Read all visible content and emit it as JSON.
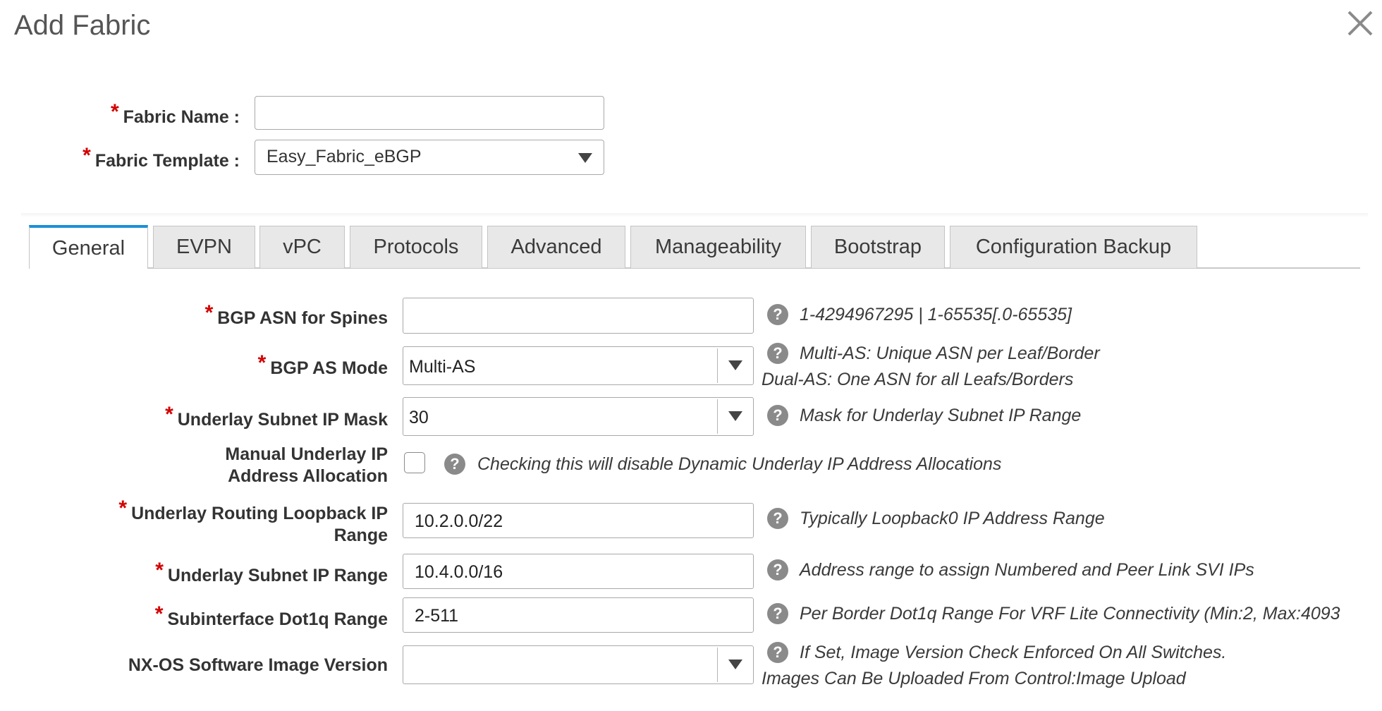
{
  "dialog": {
    "title": "Add Fabric",
    "close_icon": "close-icon"
  },
  "required_marker": "*",
  "fabric_name": {
    "label": "Fabric Name :",
    "value": ""
  },
  "fabric_template": {
    "label": "Fabric Template :",
    "selected": "Easy_Fabric_eBGP"
  },
  "tabs": [
    {
      "label": "General",
      "active": true
    },
    {
      "label": "EVPN",
      "active": false
    },
    {
      "label": "vPC",
      "active": false
    },
    {
      "label": "Protocols",
      "active": false
    },
    {
      "label": "Advanced",
      "active": false
    },
    {
      "label": "Manageability",
      "active": false
    },
    {
      "label": "Bootstrap",
      "active": false
    },
    {
      "label": "Configuration Backup",
      "active": false
    }
  ],
  "general": {
    "bgp_asn": {
      "label": "BGP ASN for Spines",
      "value": "",
      "hint": "1-4294967295 | 1-65535[.0-65535]"
    },
    "bgp_as_mode": {
      "label": "BGP AS Mode",
      "selected": "Multi-AS",
      "hint_line1": "Multi-AS: Unique ASN per Leaf/Border",
      "hint_line2": "Dual-AS: One ASN for all Leafs/Borders"
    },
    "underlay_subnet_mask": {
      "label": "Underlay Subnet IP Mask",
      "selected": "30",
      "hint": "Mask for Underlay Subnet IP Range"
    },
    "manual_underlay": {
      "label_line1": "Manual Underlay IP",
      "label_line2": "Address Allocation",
      "checked": false,
      "hint": "Checking this will disable Dynamic Underlay IP Address Allocations"
    },
    "loopback_range": {
      "label_line1": "Underlay Routing Loopback IP",
      "label_line2": "Range",
      "value": "10.2.0.0/22",
      "hint": "Typically Loopback0 IP Address Range"
    },
    "subnet_range": {
      "label": "Underlay Subnet IP Range",
      "value": "10.4.0.0/16",
      "hint": "Address range to assign Numbered and Peer Link SVI IPs"
    },
    "dot1q_range": {
      "label": "Subinterface Dot1q Range",
      "value": "2-511",
      "hint": "Per Border Dot1q Range For VRF Lite Connectivity (Min:2, Max:4093"
    },
    "nxos_image": {
      "label": "NX-OS Software Image Version",
      "selected": "",
      "hint_line1": "If Set, Image Version Check Enforced On All Switches.",
      "hint_line2": "Images Can Be Uploaded From Control:Image Upload"
    }
  },
  "help_glyph": "?",
  "colors": {
    "required": "#d40000",
    "active_tab_accent": "#1e8fd6",
    "help_icon": "#8a8a8a"
  }
}
